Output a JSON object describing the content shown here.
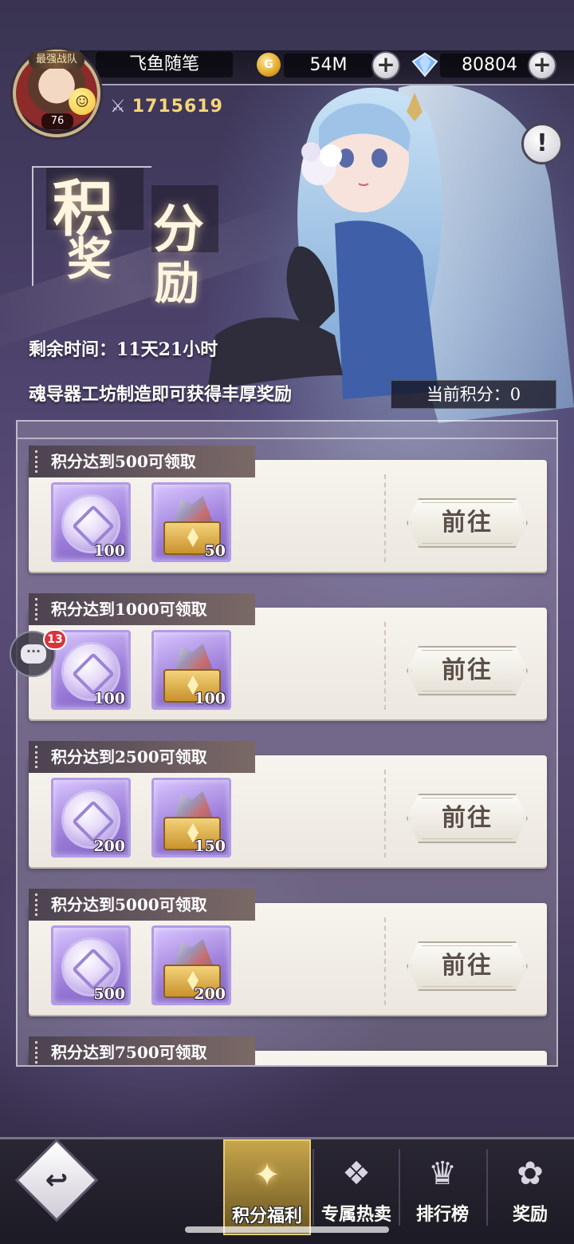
{
  "player": {
    "name": "飞鱼随笔",
    "avatar_tag": "最强战队",
    "level": "76",
    "power": "1715619"
  },
  "resources": {
    "gold": "54M",
    "gems": "80804"
  },
  "event": {
    "title_chars": [
      "积",
      "奖",
      "分",
      "励"
    ],
    "remaining": "剩余时间：11天21小时",
    "description": "魂导器工坊制造即可获得丰厚奖励",
    "current_score": "当前积分：0"
  },
  "tasks": [
    {
      "label": "积分达到500可领取",
      "items": [
        {
          "icon": "purple-coin-icon",
          "qty": "100"
        },
        {
          "icon": "chest-icon",
          "qty": "50"
        }
      ],
      "button": "前往"
    },
    {
      "label": "积分达到1000可领取",
      "items": [
        {
          "icon": "purple-coin-icon",
          "qty": "100"
        },
        {
          "icon": "chest-icon",
          "qty": "100"
        }
      ],
      "button": "前往"
    },
    {
      "label": "积分达到2500可领取",
      "items": [
        {
          "icon": "purple-coin-icon",
          "qty": "200"
        },
        {
          "icon": "chest-icon",
          "qty": "150"
        }
      ],
      "button": "前往"
    },
    {
      "label": "积分达到5000可领取",
      "items": [
        {
          "icon": "purple-coin-icon",
          "qty": "500"
        },
        {
          "icon": "chest-icon",
          "qty": "200"
        }
      ],
      "button": "前往"
    },
    {
      "label": "积分达到7500可领取"
    }
  ],
  "chat": {
    "badge": "13"
  },
  "nav": {
    "tabs": [
      {
        "label": "积分福利",
        "icon": "star-emblem-icon",
        "active": true
      },
      {
        "label": "专属热卖",
        "icon": "gift-box-icon",
        "active": false
      },
      {
        "label": "排行榜",
        "icon": "ranking-crest-icon",
        "active": false
      },
      {
        "label": "奖励",
        "icon": "reward-medal-icon",
        "active": false
      }
    ]
  },
  "colors": {
    "accent_gold": "#f7d677",
    "card_bg": "#f7f4ee",
    "tag_bg": "#4b4250"
  }
}
